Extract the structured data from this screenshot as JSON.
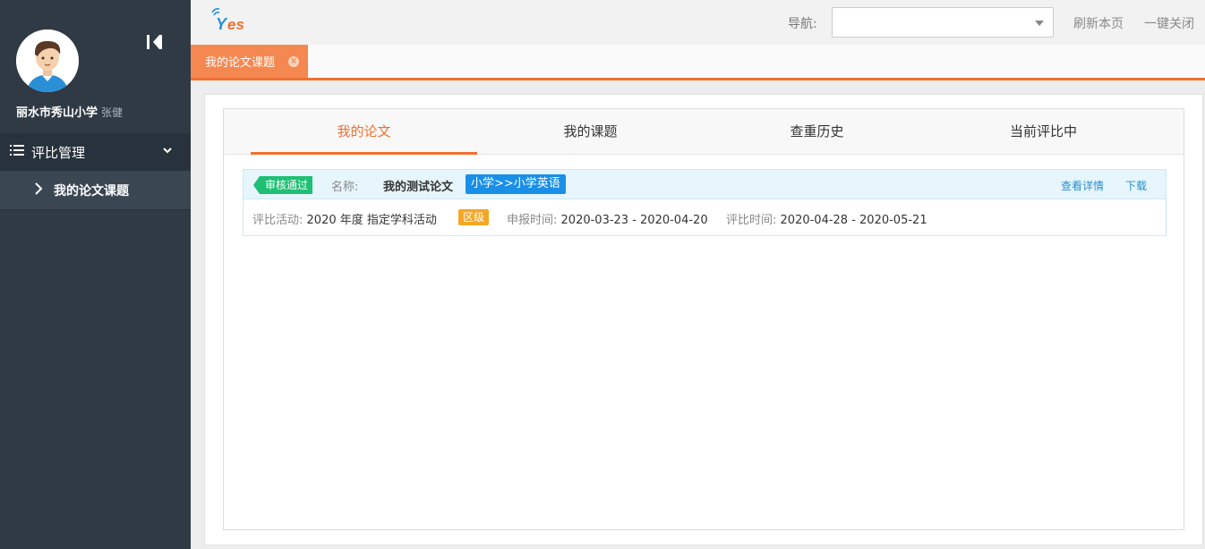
{
  "sidebar": {
    "school": "丽水市秀山小学",
    "user": "张健",
    "menu_group": "评比管理",
    "menu_item": "我的论文课题"
  },
  "topbar": {
    "nav_label": "导航:",
    "nav_value": "",
    "refresh": "刷新本页",
    "close_all": "一键关闭"
  },
  "tabbar": {
    "active_tab": "我的论文课题"
  },
  "content_tabs": [
    "我的论文",
    "我的课题",
    "查重历史",
    "当前评比中"
  ],
  "paper": {
    "status": "审核通过",
    "name_label": "名称:",
    "name": "我的测试论文",
    "subject": "小学>>小学英语",
    "view_detail": "查看详情",
    "download": "下载",
    "activity_label": "评比活动:",
    "activity": "2020 年度 指定学科活动",
    "level": "区级",
    "apply_label": "申报时间:",
    "apply_time": "2020-03-23 - 2020-04-20",
    "review_label": "评比时间:",
    "review_time": "2020-04-28 - 2020-05-21"
  },
  "colors": {
    "accent": "#f07030",
    "sidebar": "#2f3a45",
    "status_green": "#1fbf74",
    "subject_blue": "#1a8fe8",
    "level_orange": "#f5a623"
  }
}
